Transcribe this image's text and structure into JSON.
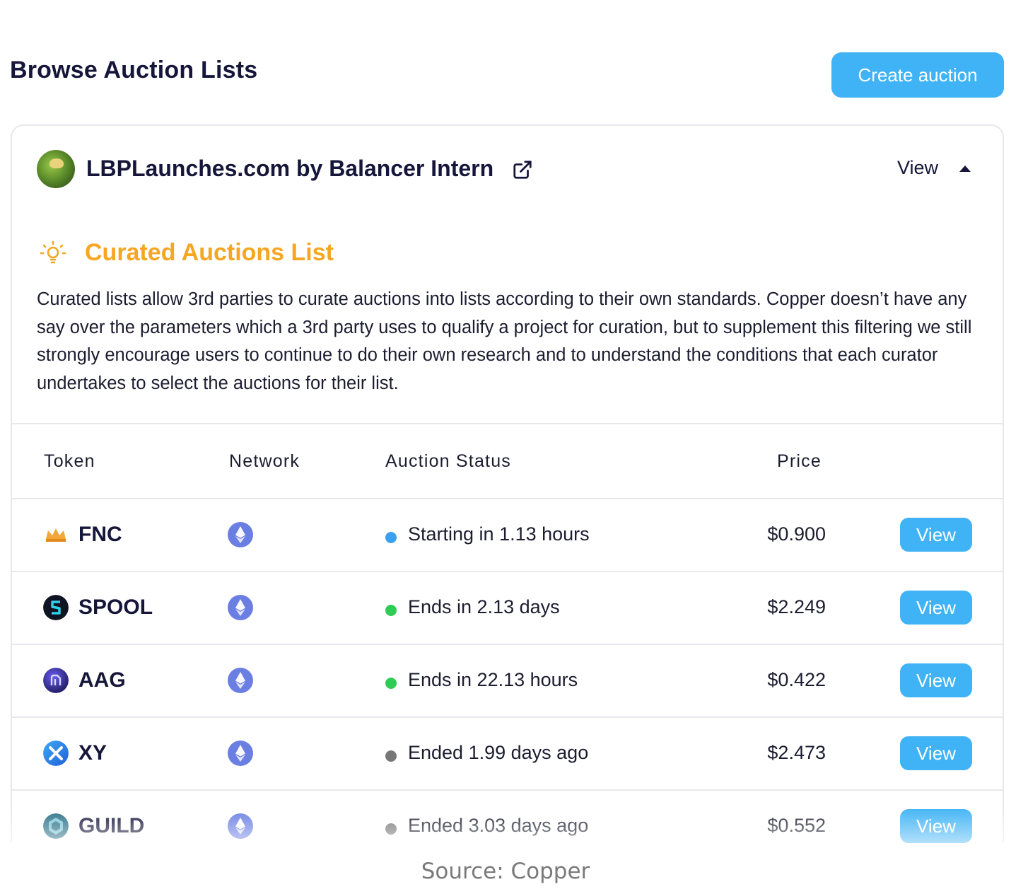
{
  "header": {
    "title": "Browse Auction Lists",
    "create_button": "Create auction"
  },
  "curator": {
    "name": "LBPLaunches.com by Balancer Intern",
    "view_label": "View"
  },
  "curated": {
    "title": "Curated Auctions List",
    "description": "Curated lists allow 3rd parties to curate auctions into lists according to their own standards. Copper doesn’t have any say over the parameters which a 3rd party uses to qualify a project for curation, but to supplement this filtering we still strongly encourage users to continue to do their own research and to understand the conditions that each curator undertakes to select the auctions for their list."
  },
  "table": {
    "columns": [
      "Token",
      "Network",
      "Auction Status",
      "Price"
    ],
    "rows": [
      {
        "token": "FNC",
        "network": "ethereum-icon",
        "status": "Starting in 1.13 hours",
        "status_color": "#3aa0f0",
        "price": "$0.900",
        "action": "View"
      },
      {
        "token": "SPOOL",
        "network": "ethereum-icon",
        "status": "Ends in 2.13 days",
        "status_color": "#2ecc55",
        "price": "$2.249",
        "action": "View"
      },
      {
        "token": "AAG",
        "network": "ethereum-icon",
        "status": "Ends in 22.13 hours",
        "status_color": "#2ecc55",
        "price": "$0.422",
        "action": "View"
      },
      {
        "token": "XY",
        "network": "ethereum-icon",
        "status": "Ended 1.99 days ago",
        "status_color": "#777777",
        "price": "$2.473",
        "action": "View"
      },
      {
        "token": "GUILD",
        "network": "ethereum-icon",
        "status": "Ended 3.03 days ago",
        "status_color": "#777777",
        "price": "$0.552",
        "action": "View"
      }
    ]
  },
  "source": "Source: Copper",
  "colors": {
    "accent": "#3fb3f5",
    "curated_title": "#f5a623",
    "text_dark": "#16163a"
  }
}
